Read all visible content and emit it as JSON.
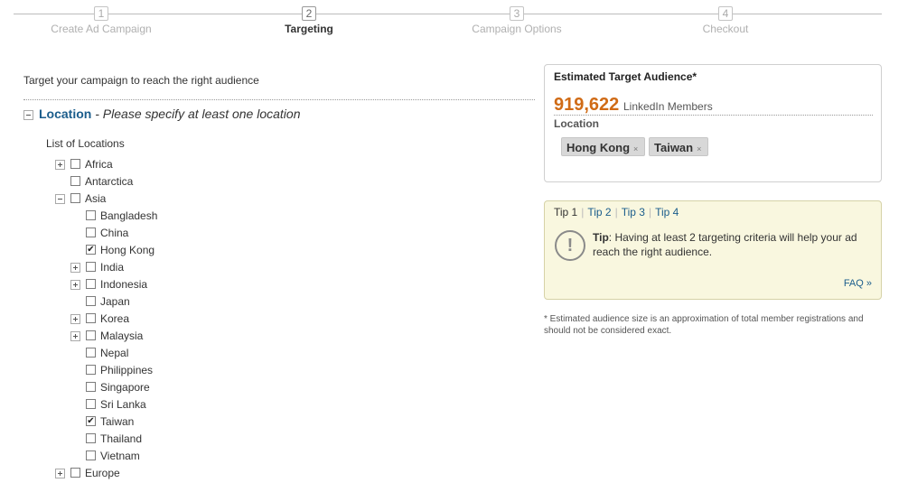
{
  "wizard": {
    "steps": [
      {
        "num": "1",
        "label": "Create Ad Campaign"
      },
      {
        "num": "2",
        "label": "Targeting"
      },
      {
        "num": "3",
        "label": "Campaign Options"
      },
      {
        "num": "4",
        "label": "Checkout"
      }
    ],
    "active_step": 2
  },
  "main": {
    "intro": "Target your campaign to reach the right audience",
    "location": {
      "title": "Location",
      "dash": " - ",
      "subtitle": "Please specify at least one location",
      "list_label": "List of Locations"
    },
    "tree": [
      {
        "label": "Africa",
        "checked": false,
        "toggle": "plus"
      },
      {
        "label": "Antarctica",
        "checked": false,
        "toggle": null
      },
      {
        "label": "Asia",
        "checked": false,
        "toggle": "minus"
      },
      {
        "label": "Bangladesh",
        "checked": false,
        "toggle": null
      },
      {
        "label": "China",
        "checked": false,
        "toggle": null
      },
      {
        "label": "Hong Kong",
        "checked": true,
        "toggle": null
      },
      {
        "label": "India",
        "checked": false,
        "toggle": "plus"
      },
      {
        "label": "Indonesia",
        "checked": false,
        "toggle": "plus"
      },
      {
        "label": "Japan",
        "checked": false,
        "toggle": null
      },
      {
        "label": "Korea",
        "checked": false,
        "toggle": "plus"
      },
      {
        "label": "Malaysia",
        "checked": false,
        "toggle": "plus"
      },
      {
        "label": "Nepal",
        "checked": false,
        "toggle": null
      },
      {
        "label": "Philippines",
        "checked": false,
        "toggle": null
      },
      {
        "label": "Singapore",
        "checked": false,
        "toggle": null
      },
      {
        "label": "Sri Lanka",
        "checked": false,
        "toggle": null
      },
      {
        "label": "Taiwan",
        "checked": true,
        "toggle": null
      },
      {
        "label": "Thailand",
        "checked": false,
        "toggle": null
      },
      {
        "label": "Vietnam",
        "checked": false,
        "toggle": null
      },
      {
        "label": "Europe",
        "checked": false,
        "toggle": "plus"
      }
    ]
  },
  "audience": {
    "title": "Estimated Target Audience*",
    "count": "919,622",
    "unit": "LinkedIn Members",
    "location_label": "Location",
    "tags": [
      {
        "label": "Hong Kong",
        "remove": "×"
      },
      {
        "label": "Taiwan",
        "remove": "×"
      }
    ]
  },
  "tips": {
    "tabs": [
      "Tip 1",
      "Tip 2",
      "Tip 3",
      "Tip 4"
    ],
    "active_tab": 0,
    "icon": "!",
    "tip_label": "Tip",
    "tip_text": ": Having at least 2 targeting criteria will help your ad reach the right audience.",
    "faq": "FAQ »"
  },
  "footnote": "* Estimated audience size is an approximation of total member registrations and should not be considered exact."
}
